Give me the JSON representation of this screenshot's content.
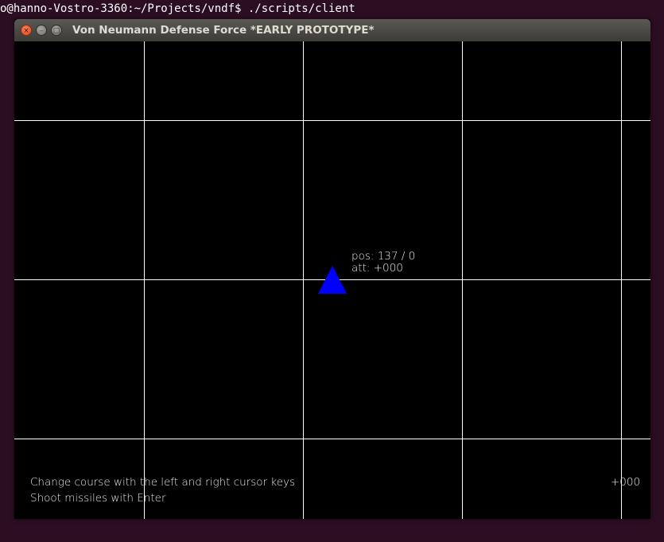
{
  "terminal": {
    "prompt_line": "o@hanno-Vostro-3360:~/Projects/vndf$ ./scripts/client"
  },
  "window": {
    "title": "Von Neumann Defense Force *EARLY PROTOTYPE*",
    "buttons": {
      "close_glyph": "×",
      "minimize_glyph": "–",
      "maximize_glyph": "□"
    }
  },
  "game": {
    "ship_color": "#0000ff",
    "grid_color": "#ffffff",
    "ship_label": {
      "pos": "pos: 137 / 0",
      "att": "att: +000"
    },
    "instructions": [
      "Change course with the left and right cursor keys",
      "Shoot missiles with Enter"
    ],
    "heading_readout": "+000"
  }
}
